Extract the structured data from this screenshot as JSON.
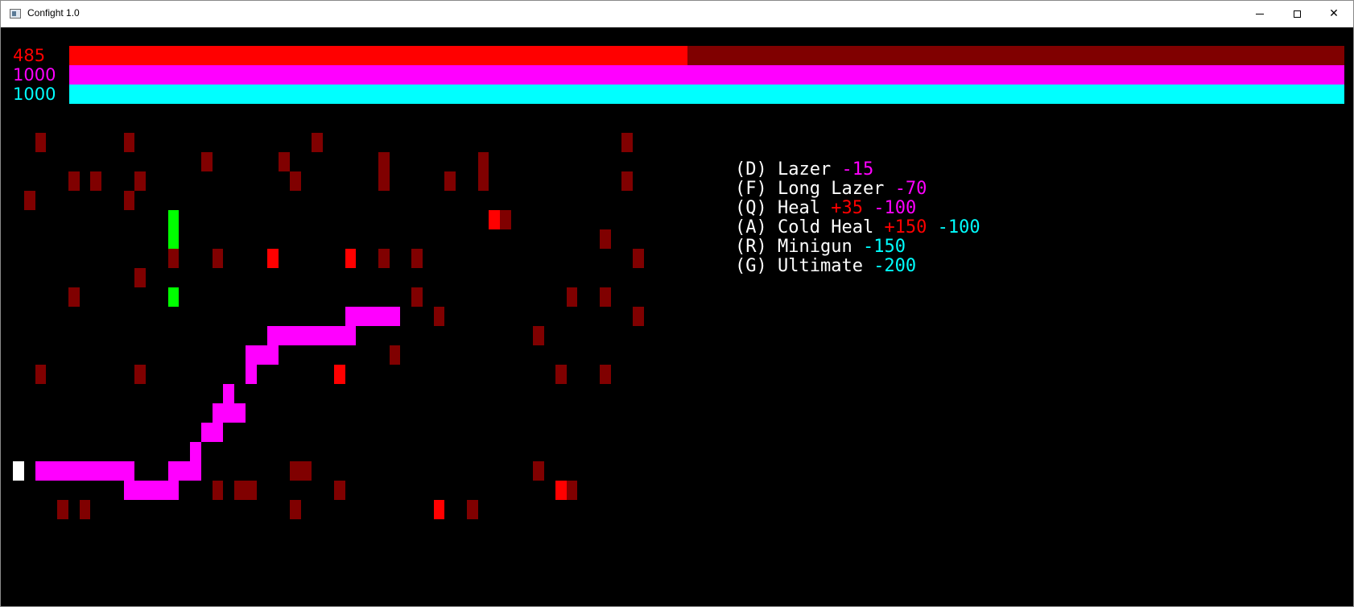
{
  "window": {
    "title": "Confight 1.0"
  },
  "colors": {
    "health": "#ff0000",
    "health_track": "#800000",
    "mana": "#ff00ff",
    "cold": "#00ffff",
    "enemy_dim": "#800000",
    "enemy_bright": "#ff0000",
    "trail": "#ff00ff",
    "player": "#ffffff",
    "ally": "#00ff00",
    "text": "#ffffff"
  },
  "bars": [
    {
      "id": "health",
      "label": "485",
      "value": 485,
      "max": 1000,
      "color": "#ff0000",
      "track": "#800000"
    },
    {
      "id": "mana",
      "label": "1000",
      "value": 1000,
      "max": 1000,
      "color": "#ff00ff",
      "track": "#800080"
    },
    {
      "id": "cold",
      "label": "1000",
      "value": 1000,
      "max": 1000,
      "color": "#00ffff",
      "track": "#008080"
    }
  ],
  "moves": [
    {
      "name": "(D) Lazer ",
      "costs": [
        {
          "text": "-15",
          "color": "#ff00ff"
        }
      ]
    },
    {
      "name": "(F) Long Lazer ",
      "costs": [
        {
          "text": "-70",
          "color": "#ff00ff"
        }
      ]
    },
    {
      "name": "(Q) Heal ",
      "costs": [
        {
          "text": "+35",
          "color": "#ff0000"
        },
        {
          "text": " ",
          "color": "#ffffff"
        },
        {
          "text": "-100",
          "color": "#ff00ff"
        }
      ]
    },
    {
      "name": "(A) Cold Heal ",
      "costs": [
        {
          "text": "+150",
          "color": "#ff0000"
        },
        {
          "text": " ",
          "color": "#ffffff"
        },
        {
          "text": "-100",
          "color": "#00ffff"
        }
      ]
    },
    {
      "name": "(R) Minigun ",
      "costs": [
        {
          "text": "-150",
          "color": "#00ffff"
        }
      ]
    },
    {
      "name": "(G) Ultimate ",
      "costs": [
        {
          "text": "-200",
          "color": "#00ffff"
        }
      ]
    }
  ]
}
